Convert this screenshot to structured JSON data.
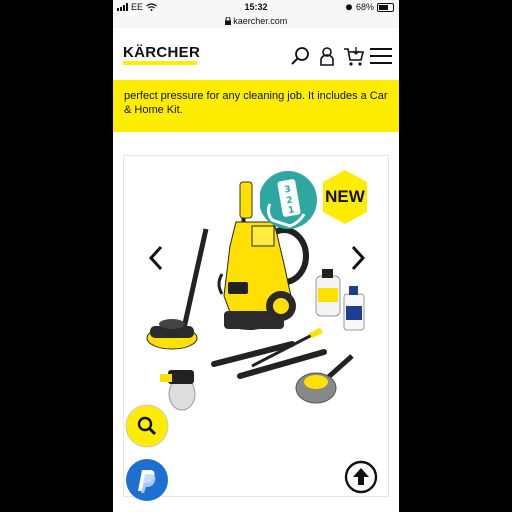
{
  "status_bar": {
    "carrier": "EE",
    "time": "15:32",
    "battery": "68%",
    "battery_level": 0.68
  },
  "browser": {
    "url": "kaercher.com"
  },
  "header": {
    "logo_text": "KÄRCHER",
    "icons": [
      "search-icon",
      "account-icon",
      "cart-icon",
      "menu-icon"
    ]
  },
  "intro": {
    "text": "perfect pressure for any cleaning job. It includes a Car & Home Kit."
  },
  "gallery": {
    "new_badge": "NEW",
    "steps_icon": "hand-123-steps-icon",
    "buttons": [
      "previous-arrow-icon",
      "next-arrow-icon",
      "zoom-icon",
      "paypal-icon",
      "scroll-up-icon"
    ]
  },
  "colors": {
    "brand_yellow": "#ffed00",
    "teal": "#2ea7a0",
    "paypal_blue": "#1f6fd1",
    "text": "#111111"
  }
}
